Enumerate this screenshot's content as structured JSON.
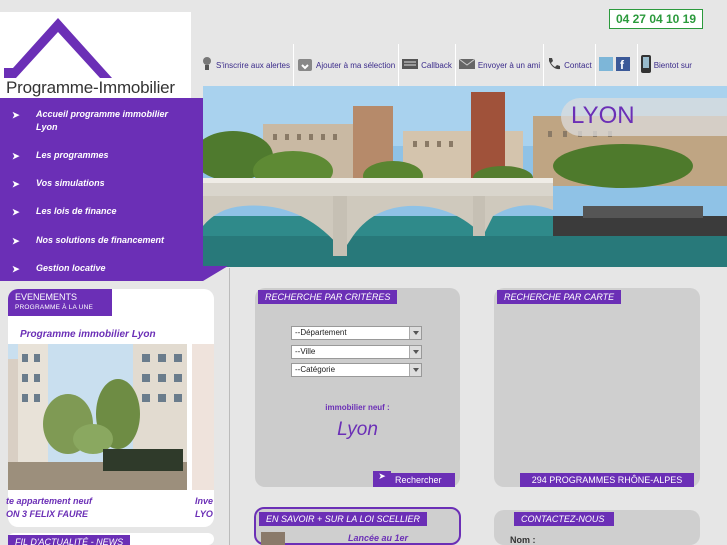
{
  "logo": {
    "text": "Programme-Immobilier"
  },
  "phone": "04 27 04 10 19",
  "topnav": [
    {
      "label": "S'inscrire aux alertes",
      "icon": "bulb-icon"
    },
    {
      "label": "Ajouter à ma sélection",
      "icon": "add-selection-icon"
    },
    {
      "label": "Callback",
      "icon": "keyboard-icon"
    },
    {
      "label": "Envoyer à un ami",
      "icon": "envelope-icon"
    },
    {
      "label": "Contact",
      "icon": "phone-icon"
    },
    {
      "label": "",
      "icon": "social-icon"
    },
    {
      "label": "Bientot sur",
      "icon": "mobile-icon"
    }
  ],
  "menu": [
    {
      "label": "Accueil programme immobilier Lyon",
      "line1": "Accueil programme immobilier",
      "line2": "Lyon"
    },
    {
      "label": "Les programmes"
    },
    {
      "label": "Vos simulations"
    },
    {
      "label": "Les lois de finance"
    },
    {
      "label": "Nos solutions de financement"
    },
    {
      "label": "Gestion locative"
    }
  ],
  "banner": {
    "city": "LYON"
  },
  "events": {
    "header": "EVENEMENTS",
    "sub": "PROGRAMME À LA UNE",
    "title": "Programme immobilier Lyon",
    "caption1": "te appartement neuf",
    "caption2": "ON 3 FELIX FAURE",
    "caption3": "Inve",
    "caption4": "LYO"
  },
  "search": {
    "header": "RECHERCHE PAR CRITÈRES",
    "selects": [
      "--Département",
      "--Ville",
      "--Catégorie"
    ],
    "neuf_label": "immobilier neuf :",
    "city": "Lyon",
    "button": "Rechercher"
  },
  "map": {
    "header": "RECHERCHE PAR CARTE",
    "footer": "294 PROGRAMMES RHÔNE-ALPES"
  },
  "scellier": {
    "header": "EN SAVOIR + SUR LA LOI SCELLIER",
    "text": "Lancée au 1er"
  },
  "contact": {
    "header": "CONTACTEZ-NOUS",
    "nom_label": "Nom :"
  },
  "fil": {
    "header": "FIL D'ACTUALITÉ - NEWS"
  },
  "colors": {
    "purple": "#6b2fb6",
    "green": "#2b9a3c"
  }
}
